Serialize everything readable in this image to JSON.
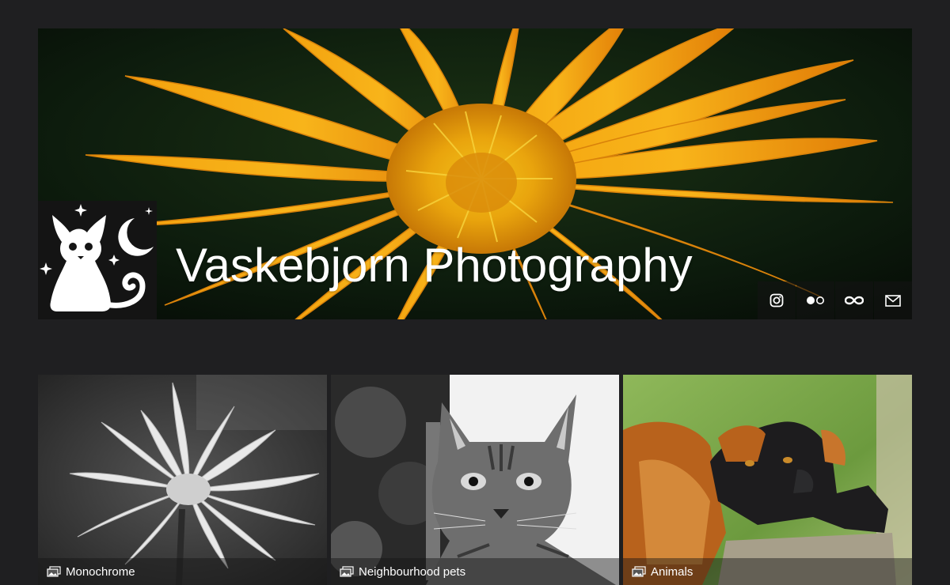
{
  "site": {
    "title": "Vaskebjorn Photography"
  },
  "header": {
    "logo_icon": "cat-moon-stars-logo",
    "social_links": [
      {
        "icon": "instagram-icon"
      },
      {
        "icon": "flickr-icon"
      },
      {
        "icon": "500px-icon"
      },
      {
        "icon": "email-icon"
      }
    ]
  },
  "galleries": [
    {
      "label": "Monochrome",
      "icon": "gallery-icon"
    },
    {
      "label": "Neighbourhood pets",
      "icon": "gallery-icon"
    },
    {
      "label": "Animals",
      "icon": "gallery-icon"
    }
  ],
  "colors": {
    "background": "#1f1f21",
    "text": "#ffffff",
    "accent_orange": "#f29a10"
  }
}
